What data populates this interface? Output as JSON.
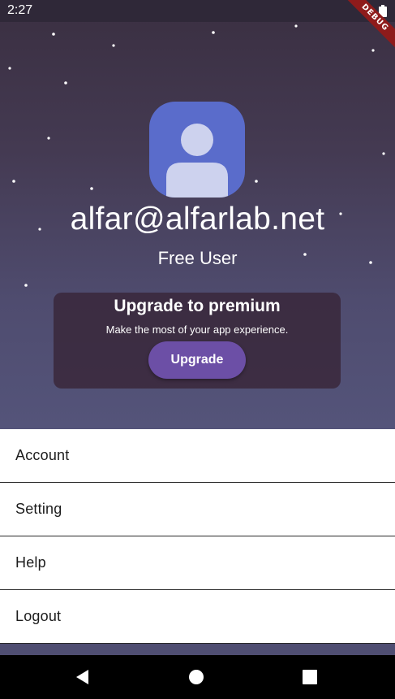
{
  "status_bar": {
    "time": "2:27"
  },
  "debug_banner": "DEBUG",
  "profile": {
    "email": "alfar@alfarlab.net",
    "user_type": "Free User",
    "avatar_icon": "person-icon"
  },
  "promo": {
    "title": "Upgrade to premium",
    "subtitle": "Make the most of your app experience.",
    "button_label": "Upgrade"
  },
  "menu": {
    "items": [
      {
        "label": "Account"
      },
      {
        "label": "Setting"
      },
      {
        "label": "Help"
      },
      {
        "label": "Logout"
      }
    ]
  },
  "nav_bar": {
    "back_icon": "back-triangle-icon",
    "home_icon": "home-circle-icon",
    "recents_icon": "recents-square-icon"
  },
  "colors": {
    "hero_top": "#3a2f41",
    "hero_bottom": "#54547a",
    "avatar_bg": "#5a6ccb",
    "avatar_fg": "#cdd2ee",
    "upgrade_button": "#6c4fa6",
    "debug_ribbon": "#8e1b1b"
  }
}
